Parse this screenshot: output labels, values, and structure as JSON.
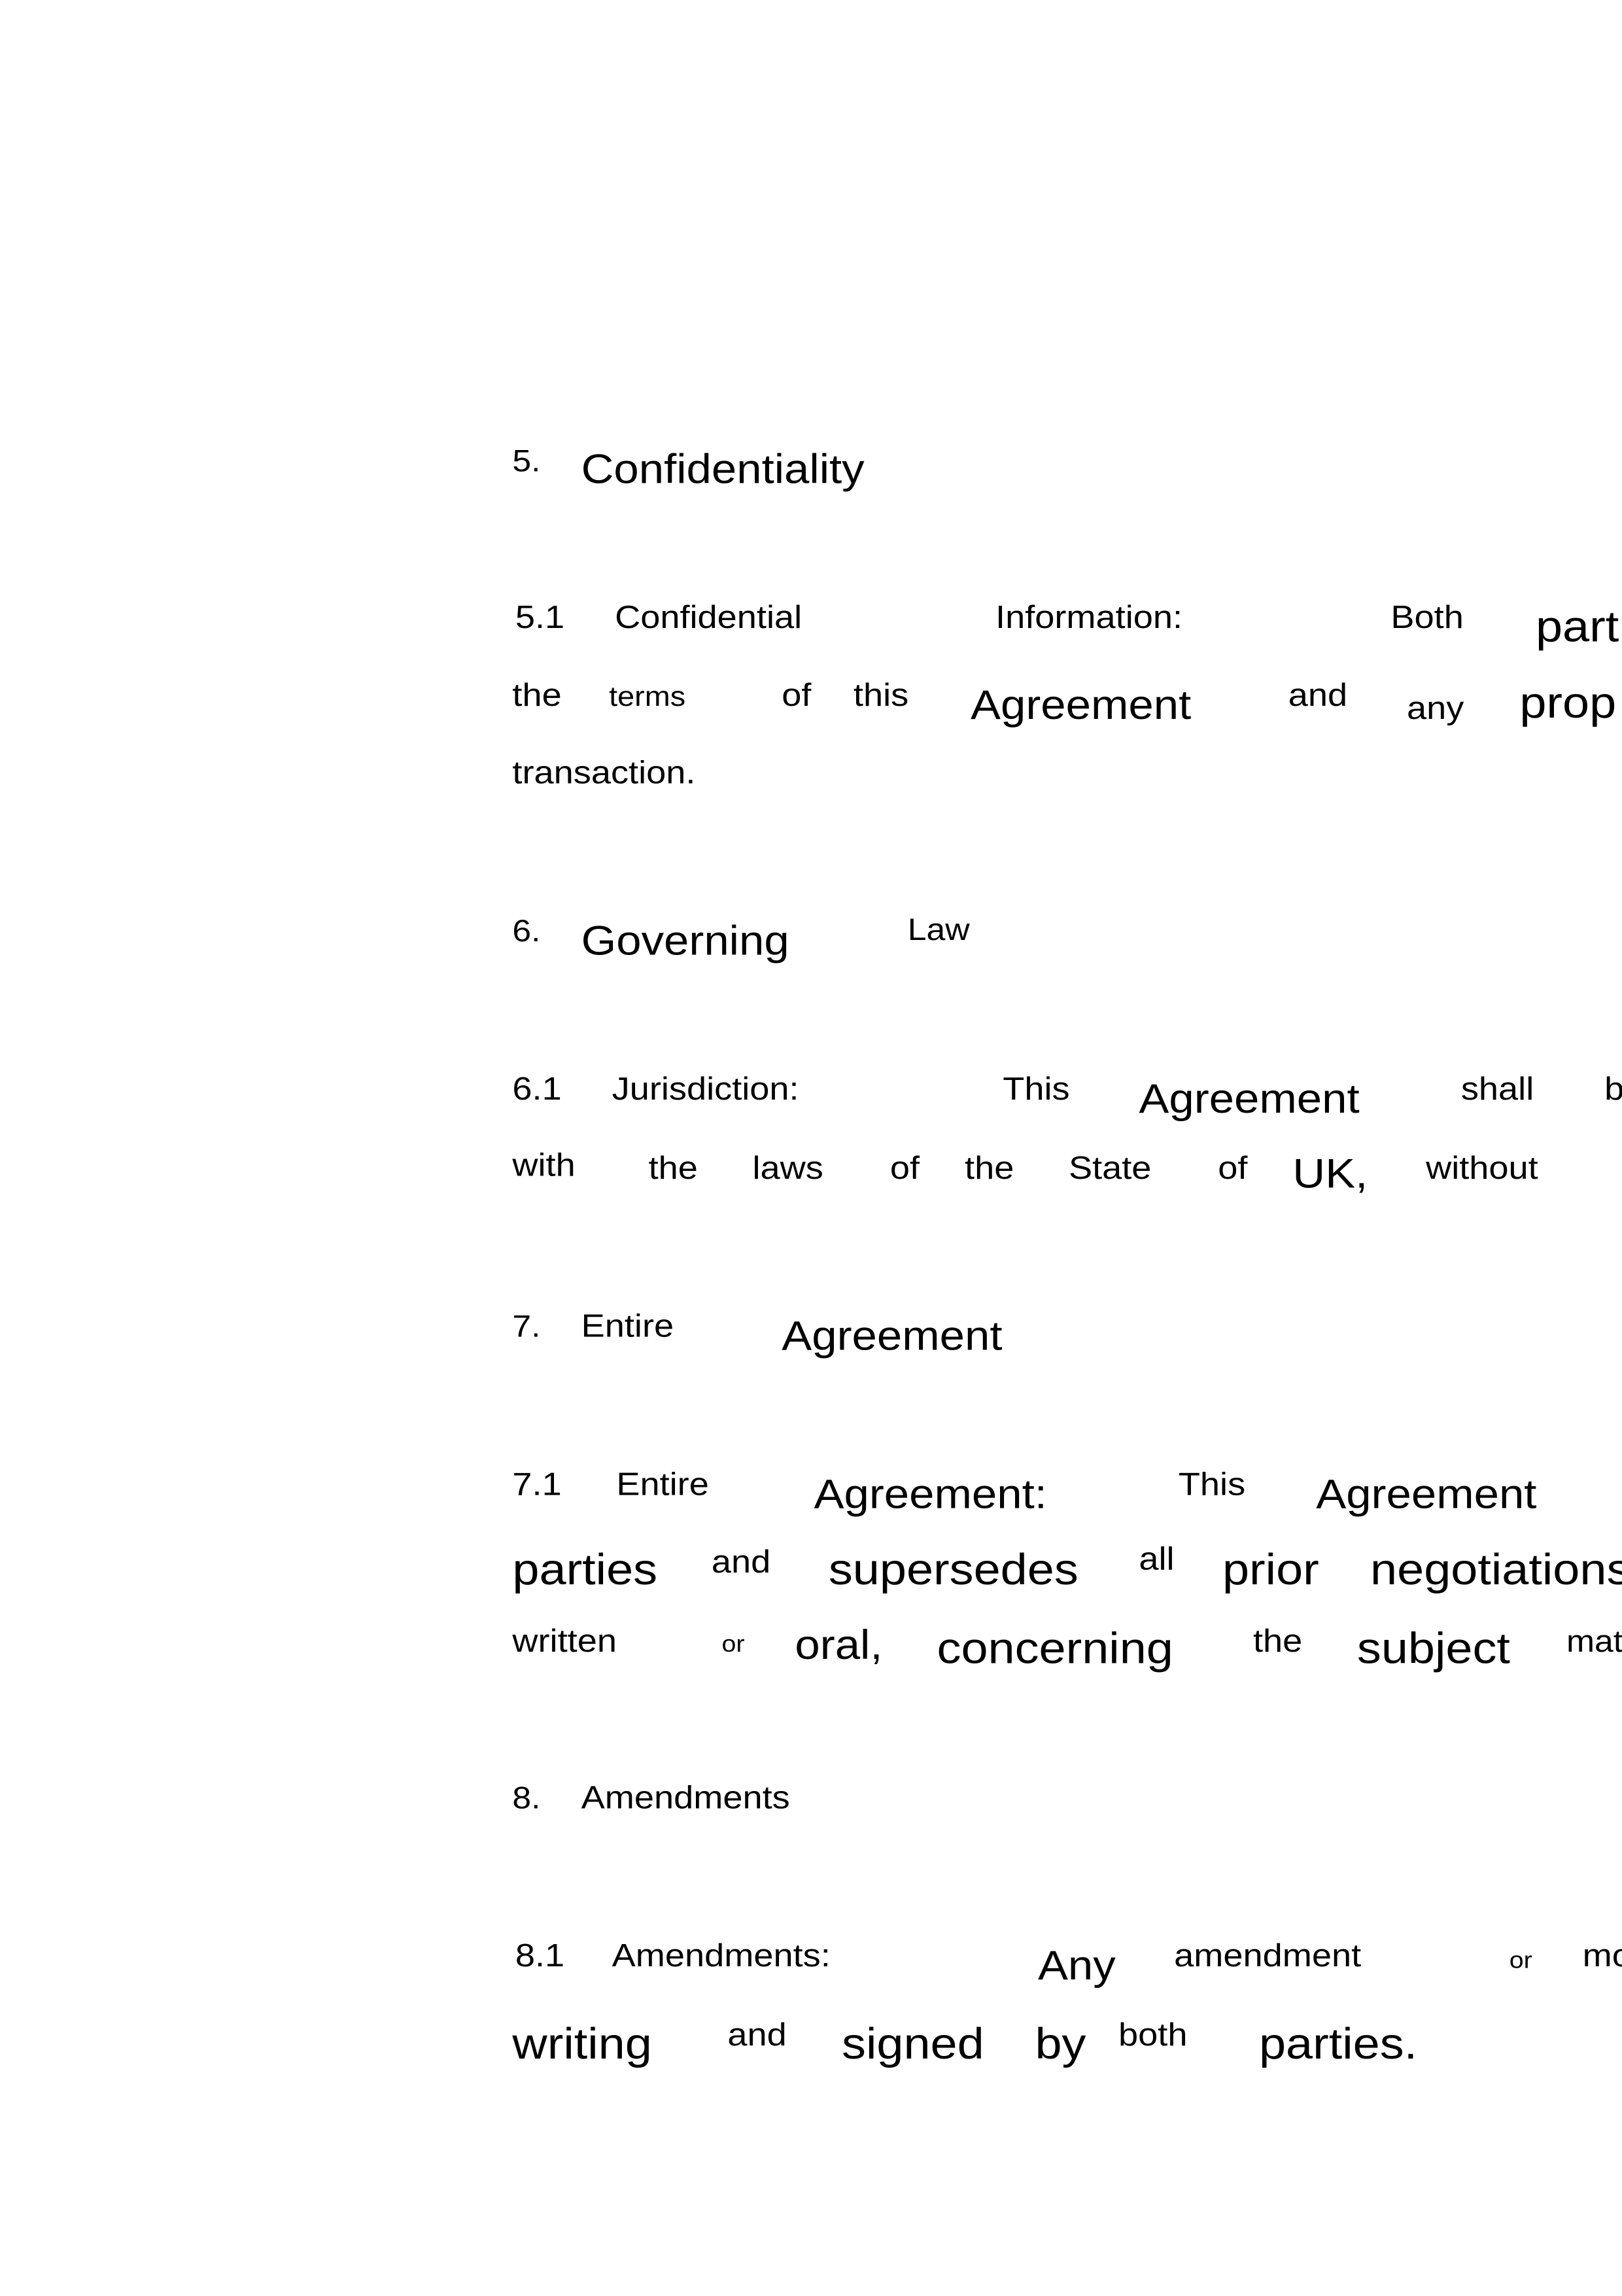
{
  "lines": [
    {
      "w": [
        "5.",
        "Confidentiality"
      ]
    },
    {
      "w": [
        "5.1",
        "Confidential",
        "Information:",
        "Both",
        "part"
      ]
    },
    {
      "w": [
        "the",
        "terms",
        "of",
        "this",
        "Agreement",
        "and",
        "any",
        "prop"
      ]
    },
    {
      "w": [
        "transaction."
      ]
    },
    {
      "w": [
        "6.",
        "Governing",
        "Law"
      ]
    },
    {
      "w": [
        "6.1",
        "Jurisdiction:",
        "This",
        "Agreement",
        "shall",
        "b"
      ]
    },
    {
      "w": [
        "with",
        "the",
        "laws",
        "of",
        "the",
        "State",
        "of",
        "UK,",
        "without"
      ]
    },
    {
      "w": [
        "7.",
        "Entire",
        "Agreement"
      ]
    },
    {
      "w": [
        "7.1",
        "Entire",
        "Agreement:",
        "This",
        "Agreement"
      ]
    },
    {
      "w": [
        "parties",
        "and",
        "supersedes",
        "all",
        "prior",
        "negotiations"
      ]
    },
    {
      "w": [
        "written",
        "or",
        "oral,",
        "concerning",
        "the",
        "subject",
        "mat"
      ]
    },
    {
      "w": [
        "8.",
        "Amendments"
      ]
    },
    {
      "w": [
        "8.1",
        "Amendments:",
        "Any",
        "amendment",
        "or",
        "mo"
      ]
    },
    {
      "w": [
        "writing",
        "and",
        "signed",
        "by",
        "both",
        "parties."
      ]
    }
  ]
}
